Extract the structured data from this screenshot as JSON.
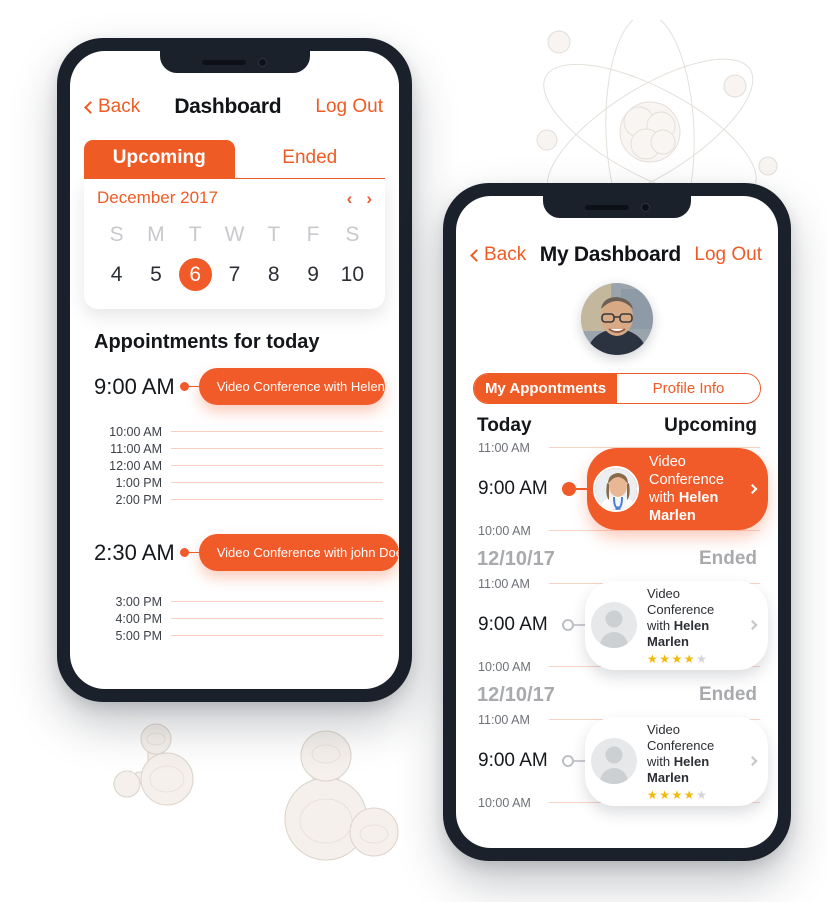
{
  "theme": {
    "accent": "#f15a29",
    "accent_text": "#ef5b25",
    "frame": "#1b212a",
    "star_on": "#f0b90b",
    "star_off": "#d3d5d9"
  },
  "left_phone": {
    "nav": {
      "back_label": "Back",
      "title": "Dashboard",
      "logout_label": "Log Out"
    },
    "tabs": [
      {
        "label": "Upcoming",
        "active": true
      },
      {
        "label": "Ended",
        "active": false
      }
    ],
    "calendar": {
      "month_label": "December 2017",
      "prev_arrow": "‹",
      "next_arrow": "›",
      "day_initials": [
        "S",
        "M",
        "T",
        "W",
        "T",
        "F",
        "S"
      ],
      "dates": [
        "4",
        "5",
        "6",
        "7",
        "8",
        "9",
        "10"
      ],
      "selected_date": "6"
    },
    "section_title": "Appointments for today",
    "appointments": [
      {
        "time": "9:00 AM",
        "label": "Video Conference with Helen Marlen",
        "overflow": true
      },
      {
        "time": "2:30 AM",
        "label": "Video Conference with john Doe",
        "overflow": false
      }
    ],
    "slots_upper": [
      "10:00 AM",
      "11:00 AM",
      "12:00 AM",
      "1:00 PM",
      "2:00 PM"
    ],
    "slots_lower": [
      "3:00 PM",
      "4:00 PM",
      "5:00 PM"
    ]
  },
  "right_phone": {
    "nav": {
      "back_label": "Back",
      "title": "My Dashboard",
      "logout_label": "Log Out"
    },
    "segments": [
      {
        "label": "My Appontments",
        "active": true
      },
      {
        "label": "Profile Info",
        "active": false
      }
    ],
    "today_row": {
      "left": "Today",
      "right": "Upcoming"
    },
    "timeline": [
      {
        "kind": "rule",
        "time": "11:00 AM"
      },
      {
        "kind": "event",
        "time": "9:00 AM",
        "state": "active",
        "line1": "Video Conference",
        "line2_prefix": "with ",
        "line2_name": "Helen Marlen",
        "chevron": "›",
        "avatar": "doctor-photo"
      },
      {
        "kind": "rule",
        "time": "10:00 AM"
      },
      {
        "kind": "separator",
        "date": "12/10/17",
        "state": "Ended"
      },
      {
        "kind": "rule",
        "time": "11:00 AM"
      },
      {
        "kind": "event",
        "time": "9:00 AM",
        "state": "ended",
        "line1": "Video Conference",
        "line2_prefix": "with ",
        "line2_name": "Helen Marlen",
        "chevron": "›",
        "avatar": "placeholder-person",
        "stars_filled": 4,
        "stars_total": 5
      },
      {
        "kind": "rule",
        "time": "10:00 AM"
      },
      {
        "kind": "separator",
        "date": "12/10/17",
        "state": "Ended"
      },
      {
        "kind": "rule",
        "time": "11:00 AM"
      },
      {
        "kind": "event",
        "time": "9:00 AM",
        "state": "ended",
        "line1": "Video Conference",
        "line2_prefix": "with ",
        "line2_name": "Helen Marlen",
        "chevron": "›",
        "avatar": "placeholder-person",
        "stars_filled": 4,
        "stars_total": 5
      },
      {
        "kind": "rule",
        "time": "10:00 AM"
      }
    ]
  }
}
